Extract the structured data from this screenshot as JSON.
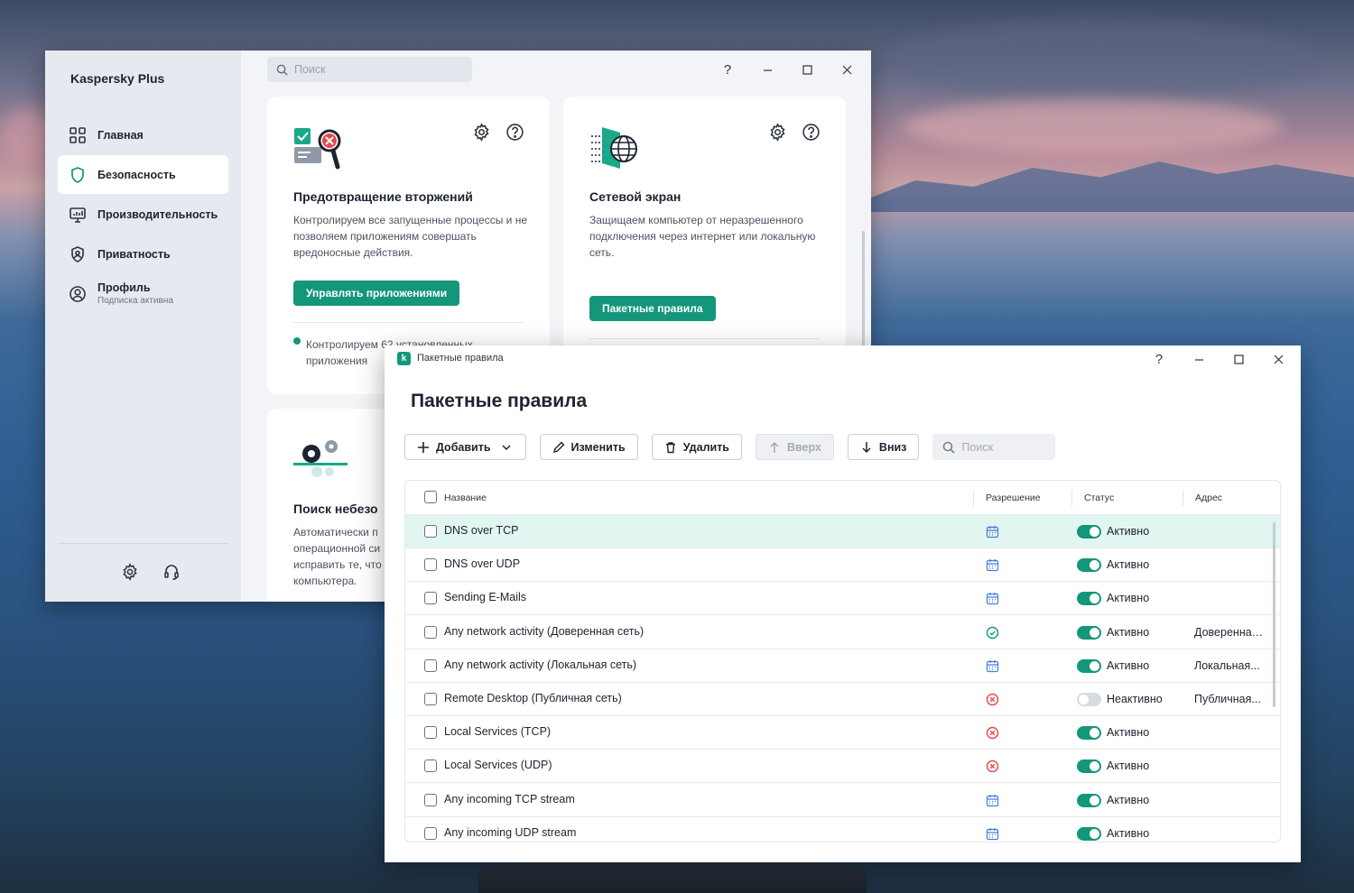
{
  "main_window": {
    "brand": "Kaspersky Plus",
    "search_placeholder": "Поиск",
    "help": "?",
    "nav": [
      {
        "label": "Главная",
        "icon": "grid-icon"
      },
      {
        "label": "Безопасность",
        "icon": "shield-icon",
        "active": true
      },
      {
        "label": "Производительность",
        "icon": "monitor-icon"
      },
      {
        "label": "Приватность",
        "icon": "privacy-shield-icon"
      },
      {
        "label": "Профиль",
        "sub": "Подписка активна",
        "icon": "user-icon"
      }
    ],
    "cards": [
      {
        "title": "Предотвращение вторжений",
        "desc": "Контролируем все запущенные процессы и не позволяем приложениям совершать вредоносные действия.",
        "button": "Управлять приложениями",
        "bullet": "Контролируем 62 установленных приложения"
      },
      {
        "title": "Сетевой экран",
        "desc": "Защищаем компьютер от неразрешенного подключения через интернет или локальную сеть.",
        "button": "Пакетные правила"
      },
      {
        "title": "Поиск небезо",
        "desc": "Автоматически п операционной си исправить те, что компьютера."
      }
    ]
  },
  "dialog": {
    "window_title": "Пакетные правила",
    "heading": "Пакетные правила",
    "help": "?",
    "toolbar": {
      "add": "Добавить",
      "edit": "Изменить",
      "delete": "Удалить",
      "up": "Вверх",
      "down": "Вниз",
      "search_placeholder": "Поиск"
    },
    "columns": {
      "name": "Название",
      "permission": "Разрешение",
      "status": "Статус",
      "address": "Адрес"
    },
    "rows": [
      {
        "name": "DNS over TCP",
        "permission": "schedule",
        "active": true,
        "status": "Активно",
        "address": ""
      },
      {
        "name": "DNS over UDP",
        "permission": "schedule",
        "active": true,
        "status": "Активно",
        "address": ""
      },
      {
        "name": "Sending E-Mails",
        "permission": "schedule",
        "active": true,
        "status": "Активно",
        "address": ""
      },
      {
        "name": "Any network activity (Доверенная сеть)",
        "permission": "allow",
        "active": true,
        "status": "Активно",
        "address": "Доверенная..."
      },
      {
        "name": "Any network activity (Локальная сеть)",
        "permission": "schedule",
        "active": true,
        "status": "Активно",
        "address": "Локальная..."
      },
      {
        "name": "Remote Desktop (Публичная сеть)",
        "permission": "block",
        "active": false,
        "status": "Неактивно",
        "address": "Публичная..."
      },
      {
        "name": "Local Services (TCP)",
        "permission": "block",
        "active": true,
        "status": "Активно",
        "address": ""
      },
      {
        "name": "Local Services (UDP)",
        "permission": "block",
        "active": true,
        "status": "Активно",
        "address": ""
      },
      {
        "name": "Any incoming TCP stream",
        "permission": "schedule",
        "active": true,
        "status": "Активно",
        "address": ""
      },
      {
        "name": "Any incoming UDP stream",
        "permission": "schedule",
        "active": true,
        "status": "Активно",
        "address": ""
      }
    ]
  },
  "colors": {
    "accent": "#14967a",
    "block": "#e5484d",
    "schedule": "#4a7bd8"
  }
}
